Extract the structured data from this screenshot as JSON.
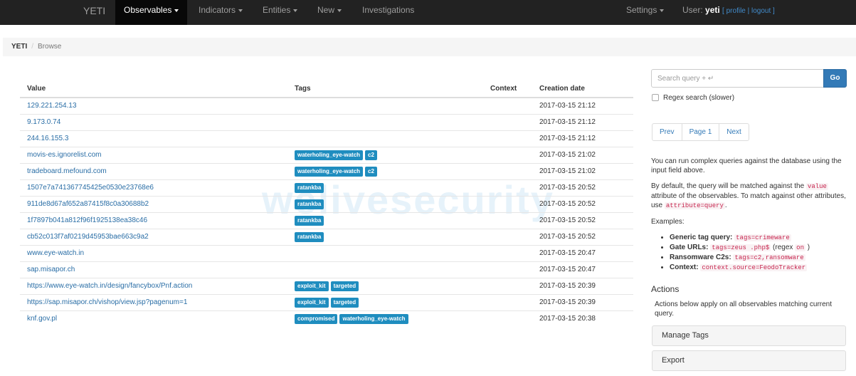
{
  "nav": {
    "brand": "YETI",
    "items": [
      {
        "label": "Observables",
        "dropdown": true,
        "active": true
      },
      {
        "label": "Indicators",
        "dropdown": true
      },
      {
        "label": "Entities",
        "dropdown": true
      },
      {
        "label": "New",
        "dropdown": true
      },
      {
        "label": "Investigations",
        "dropdown": false
      }
    ],
    "settings_label": "Settings",
    "user_prefix": "User:",
    "username": "yeti",
    "profile_label": "profile",
    "logout_label": "logout"
  },
  "breadcrumb": {
    "home": "YETI",
    "separator": "/",
    "current": "Browse"
  },
  "table": {
    "columns": [
      "Value",
      "Tags",
      "Context",
      "Creation date"
    ],
    "rows": [
      {
        "value": "129.221.254.13",
        "tags": [],
        "date": "2017-03-15 21:12"
      },
      {
        "value": "9.173.0.74",
        "tags": [],
        "date": "2017-03-15 21:12"
      },
      {
        "value": "244.16.155.3",
        "tags": [],
        "date": "2017-03-15 21:12"
      },
      {
        "value": "movis-es.ignorelist.com",
        "tags": [
          "waterholing_eye-watch",
          "c2"
        ],
        "date": "2017-03-15 21:02"
      },
      {
        "value": "tradeboard.mefound.com",
        "tags": [
          "waterholing_eye-watch",
          "c2"
        ],
        "date": "2017-03-15 21:02"
      },
      {
        "value": "1507e7a741367745425e0530e23768e6",
        "tags": [
          "ratankba"
        ],
        "date": "2017-03-15 20:52"
      },
      {
        "value": "911de8d67af652a87415f8c0a30688b2",
        "tags": [
          "ratankba"
        ],
        "date": "2017-03-15 20:52"
      },
      {
        "value": "1f7897b041a812f96f1925138ea38c46",
        "tags": [
          "ratankba"
        ],
        "date": "2017-03-15 20:52"
      },
      {
        "value": "cb52c013f7af0219d45953bae663c9a2",
        "tags": [
          "ratankba"
        ],
        "date": "2017-03-15 20:52"
      },
      {
        "value": "www.eye-watch.in",
        "tags": [],
        "date": "2017-03-15 20:47"
      },
      {
        "value": "sap.misapor.ch",
        "tags": [],
        "date": "2017-03-15 20:47"
      },
      {
        "value": "https://www.eye-watch.in/design/fancybox/Pnf.action",
        "tags": [
          "exploit_kit",
          "targeted"
        ],
        "date": "2017-03-15 20:39"
      },
      {
        "value": "https://sap.misapor.ch/vishop/view.jsp?pagenum=1",
        "tags": [
          "exploit_kit",
          "targeted"
        ],
        "date": "2017-03-15 20:39"
      },
      {
        "value": "knf.gov.pl",
        "tags": [
          "compromised",
          "waterholing_eye-watch"
        ],
        "date": "2017-03-15 20:38"
      }
    ]
  },
  "watermark": "welivesecurity",
  "search": {
    "placeholder": "Search query + ↵",
    "go_label": "Go",
    "regex_label": "Regex search (slower)"
  },
  "pager": {
    "prev": "Prev",
    "page": "Page 1",
    "next": "Next"
  },
  "help": {
    "intro": "You can run complex queries against the database using the input field above.",
    "default_1": "By default, the query will be matched against the",
    "default_code": "value",
    "default_2": "attribute of the observables. To match against other attributes, use",
    "default_code2": "attribute=query",
    "default_3": ".",
    "examples_label": "Examples:",
    "examples": [
      {
        "label": "Generic tag query:",
        "code": "tags=crimeware",
        "suffix": ""
      },
      {
        "label": "Gate URLs:",
        "code": "tags=zeus .php$",
        "suffix": "(regex",
        "code2": "on",
        "suffix2": ")"
      },
      {
        "label": "Ransomware C2s:",
        "code": "tags=c2,ransomware",
        "suffix": ""
      },
      {
        "label": "Context:",
        "code": "context.source=FeodoTracker",
        "suffix": ""
      }
    ]
  },
  "actions": {
    "title": "Actions",
    "desc": "Actions below apply on all observables matching current query.",
    "manage_tags": "Manage Tags",
    "export": "Export"
  },
  "colors": {
    "navbar": "#222222",
    "tag": "#1f8dbf",
    "link": "#2a6ea6",
    "primary": "#337ab7"
  }
}
